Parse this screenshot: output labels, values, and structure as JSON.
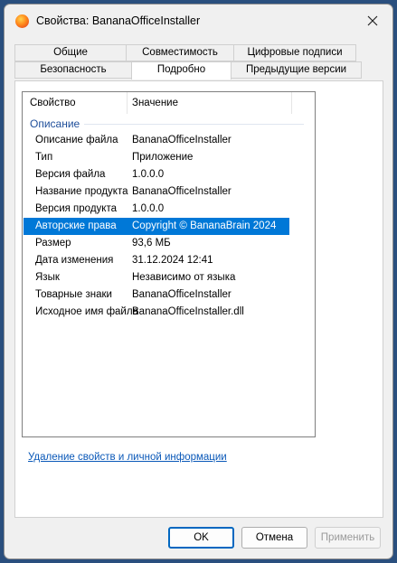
{
  "window": {
    "title": "Свойства: BananaOfficeInstaller",
    "icon": "banana-app-icon",
    "close_icon": "close-icon"
  },
  "tabs": {
    "row1": [
      "Общие",
      "Совместимость",
      "Цифровые подписи"
    ],
    "row2": [
      "Безопасность",
      "Подробно",
      "Предыдущие версии"
    ],
    "active": "Подробно"
  },
  "details": {
    "headers": {
      "property": "Свойство",
      "value": "Значение"
    },
    "group": "Описание",
    "rows": [
      {
        "property": "Описание файла",
        "value": "BananaOfficeInstaller"
      },
      {
        "property": "Тип",
        "value": "Приложение"
      },
      {
        "property": "Версия файла",
        "value": "1.0.0.0"
      },
      {
        "property": "Название продукта",
        "value": "BananaOfficeInstaller"
      },
      {
        "property": "Версия продукта",
        "value": "1.0.0.0"
      },
      {
        "property": "Авторские права",
        "value": "Copyright © BananaBrain 2024"
      },
      {
        "property": "Размер",
        "value": "93,6 МБ"
      },
      {
        "property": "Дата изменения",
        "value": "31.12.2024 12:41"
      },
      {
        "property": "Язык",
        "value": "Независимо от языка"
      },
      {
        "property": "Товарные знаки",
        "value": "BananaOfficeInstaller"
      },
      {
        "property": "Исходное имя файла",
        "value": "BananaOfficeInstaller.dll"
      }
    ],
    "selected_property": "Авторские права"
  },
  "remove_link": "Удаление свойств и личной информации",
  "buttons": {
    "ok": "OK",
    "cancel": "Отмена",
    "apply": "Применить"
  },
  "colors": {
    "selection": "#0078d7",
    "link": "#0a58b8",
    "group": "#1e4e9a"
  }
}
